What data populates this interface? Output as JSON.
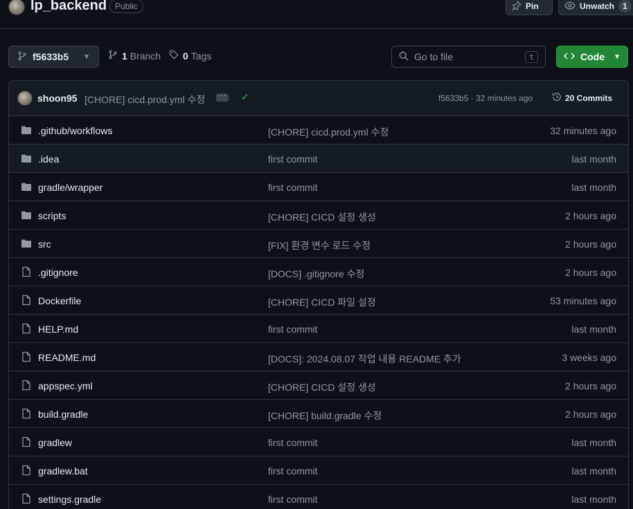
{
  "repo": {
    "name": "lp_backend",
    "visibility": "Public"
  },
  "header_actions": {
    "pin_label": "Pin",
    "watch_label": "Unwatch",
    "watch_count": "1"
  },
  "branch_bar": {
    "branch_name": "f5633b5",
    "branch_count": "1",
    "branch_label": "Branch",
    "tag_count": "0",
    "tag_label": "Tags",
    "goto_placeholder": "Go to file",
    "goto_shortcut": "t",
    "code_label": "Code"
  },
  "latest_commit": {
    "author": "shoon95",
    "message": "[CHORE] cicd.prod.yml 수정",
    "sha_time": "f5633b5 · 32 minutes ago",
    "commits_label": "20 Commits"
  },
  "files": [
    {
      "type": "folder",
      "name": ".github/workflows",
      "message": "[CHORE] cicd.prod.yml 수정",
      "date": "32 minutes ago"
    },
    {
      "type": "folder",
      "name": ".idea",
      "message": "first commit",
      "date": "last month"
    },
    {
      "type": "folder",
      "name": "gradle/wrapper",
      "message": "first commit",
      "date": "last month"
    },
    {
      "type": "folder",
      "name": "scripts",
      "message": "[CHORE] CICD 설정 생성",
      "date": "2 hours ago"
    },
    {
      "type": "folder",
      "name": "src",
      "message": "[FIX] 환경 변수 로드 수정",
      "date": "2 hours ago"
    },
    {
      "type": "file",
      "name": ".gitignore",
      "message": "[DOCS] .gitignore 수정",
      "date": "2 hours ago"
    },
    {
      "type": "file",
      "name": "Dockerfile",
      "message": "[CHORE] CICD 파일 설정",
      "date": "53 minutes ago"
    },
    {
      "type": "file",
      "name": "HELP.md",
      "message": "first commit",
      "date": "last month"
    },
    {
      "type": "file",
      "name": "README.md",
      "message": "[DOCS]: 2024.08.07 작업 내용 README 추가",
      "date": "3 weeks ago"
    },
    {
      "type": "file",
      "name": "appspec.yml",
      "message": "[CHORE] CICD 설정 생성",
      "date": "2 hours ago"
    },
    {
      "type": "file",
      "name": "build.gradle",
      "message": "[CHORE] build.gradle 수정",
      "date": "2 hours ago"
    },
    {
      "type": "file",
      "name": "gradlew",
      "message": "first commit",
      "date": "last month"
    },
    {
      "type": "file",
      "name": "gradlew.bat",
      "message": "first commit",
      "date": "last month"
    },
    {
      "type": "file",
      "name": "settings.gradle",
      "message": "first commit",
      "date": "last month"
    }
  ]
}
